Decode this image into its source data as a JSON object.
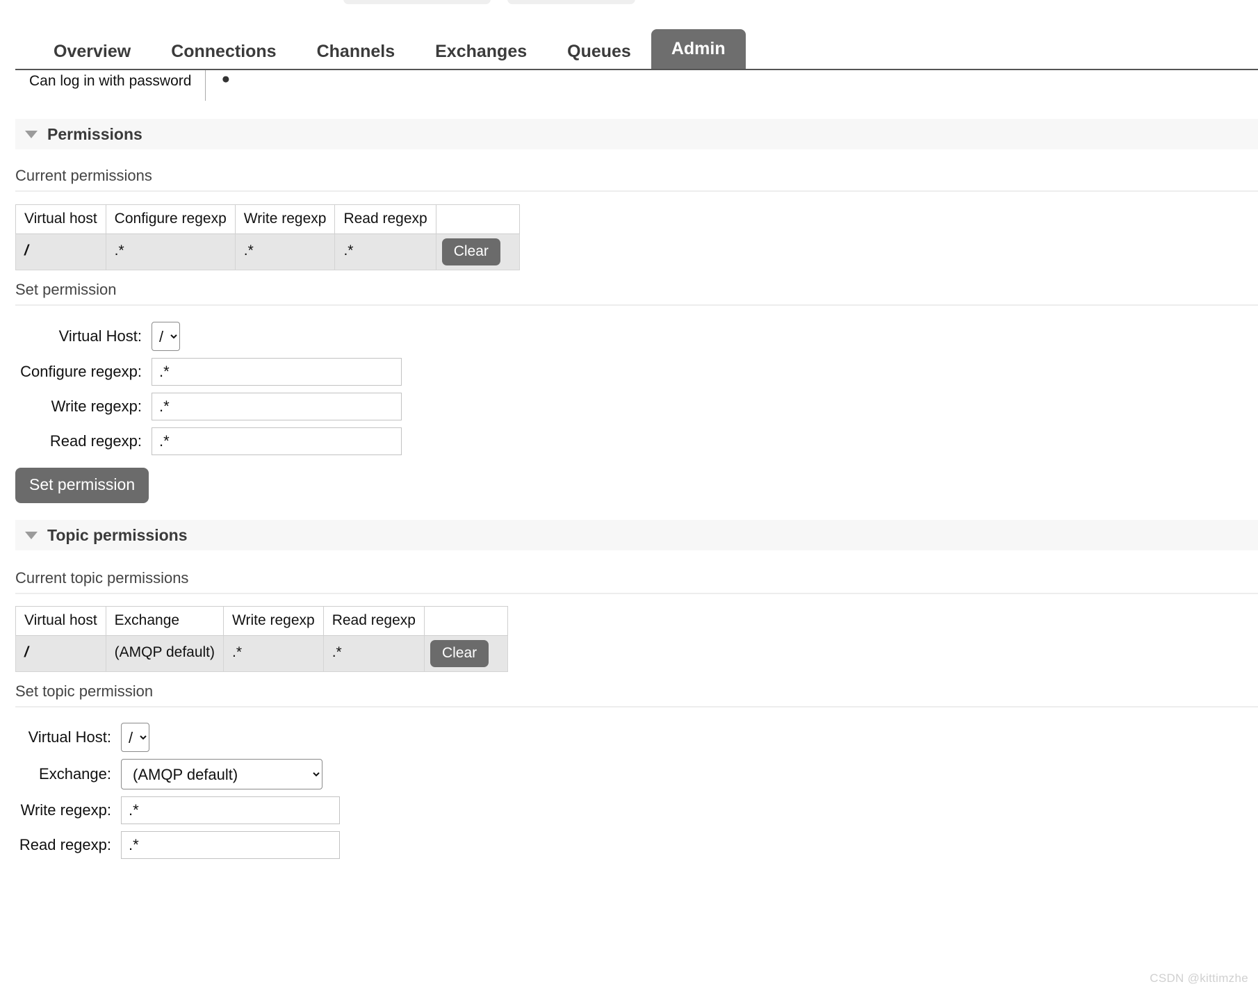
{
  "top_partial_buttons": [
    {
      "name": "partial-button-left"
    },
    {
      "name": "partial-button-right"
    }
  ],
  "nav": {
    "tabs": [
      {
        "label": "Overview",
        "active": false
      },
      {
        "label": "Connections",
        "active": false
      },
      {
        "label": "Channels",
        "active": false
      },
      {
        "label": "Exchanges",
        "active": false
      },
      {
        "label": "Queues",
        "active": false
      },
      {
        "label": "Admin",
        "active": true
      }
    ]
  },
  "user_detail": {
    "login_label": "Can log in with password",
    "login_value": "●"
  },
  "permissions_section": {
    "caret": "caret-down-icon",
    "title": "Permissions",
    "current": {
      "heading": "Current permissions",
      "columns": [
        "Virtual host",
        "Configure regexp",
        "Write regexp",
        "Read regexp",
        ""
      ],
      "rows": [
        {
          "virtual_host": "/",
          "configure_regexp": ".*",
          "write_regexp": ".*",
          "read_regexp": ".*",
          "action_label": "Clear"
        }
      ]
    },
    "set_form": {
      "heading": "Set permission",
      "vhost_label": "Virtual Host:",
      "vhost_value": "/",
      "vhost_options": [
        "/"
      ],
      "configure_label": "Configure regexp:",
      "configure_value": ".*",
      "write_label": "Write regexp:",
      "write_value": ".*",
      "read_label": "Read regexp:",
      "read_value": ".*",
      "submit_label": "Set permission"
    }
  },
  "topic_permissions_section": {
    "caret": "caret-down-icon",
    "title": "Topic permissions",
    "current": {
      "heading": "Current topic permissions",
      "columns": [
        "Virtual host",
        "Exchange",
        "Write regexp",
        "Read regexp",
        ""
      ],
      "rows": [
        {
          "virtual_host": "/",
          "exchange": "(AMQP default)",
          "write_regexp": ".*",
          "read_regexp": ".*",
          "action_label": "Clear"
        }
      ]
    },
    "set_form": {
      "heading": "Set topic permission",
      "vhost_label": "Virtual Host:",
      "vhost_value": "/",
      "vhost_options": [
        "/"
      ],
      "exchange_label": "Exchange:",
      "exchange_value": "(AMQP default)",
      "exchange_options": [
        "(AMQP default)"
      ],
      "write_label": "Write regexp:",
      "write_value": ".*",
      "read_label": "Read regexp:",
      "read_value": ".*"
    }
  },
  "watermark": "CSDN @kittimzhe",
  "colors": {
    "active_tab_bg": "#6e6e6e",
    "button_bg": "#6b6b6b",
    "section_bar_bg": "#f7f7f7",
    "table_row_bg": "#e6e6e6"
  }
}
